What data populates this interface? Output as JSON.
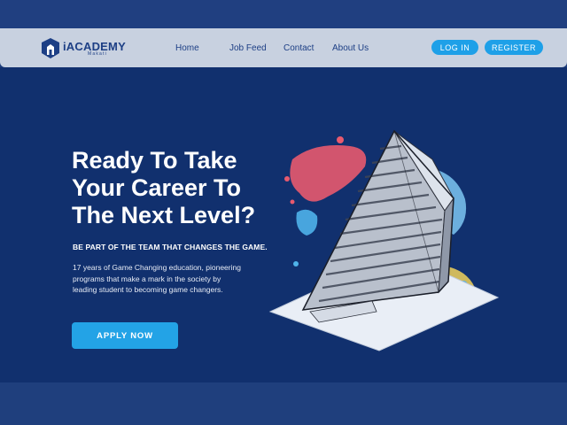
{
  "brand": {
    "name": "iACADEMY",
    "sub": "Makati"
  },
  "nav": {
    "links": [
      "Home",
      "Job Feed",
      "Contact",
      "About Us"
    ],
    "login_label": "LOG IN",
    "register_label": "REGISTER"
  },
  "hero": {
    "headline": [
      "Ready To Take",
      "Your Career To",
      "The Next Level?"
    ],
    "tagline": "BE PART OF THE TEAM THAT CHANGES THE GAME.",
    "body": "17 years of Game Changing education, pioneering programs that make a mark in the society by leading student to becoming game changers.",
    "cta_label": "APPLY NOW"
  },
  "colors": {
    "nav_bg": "#c8d1e0",
    "hero_bg": "#11306e",
    "accent": "#23a3e6",
    "brand_blue": "#1d3f85"
  },
  "icons": {
    "logo": "iacademy-shield-logo",
    "illustration": "building-illustration"
  }
}
